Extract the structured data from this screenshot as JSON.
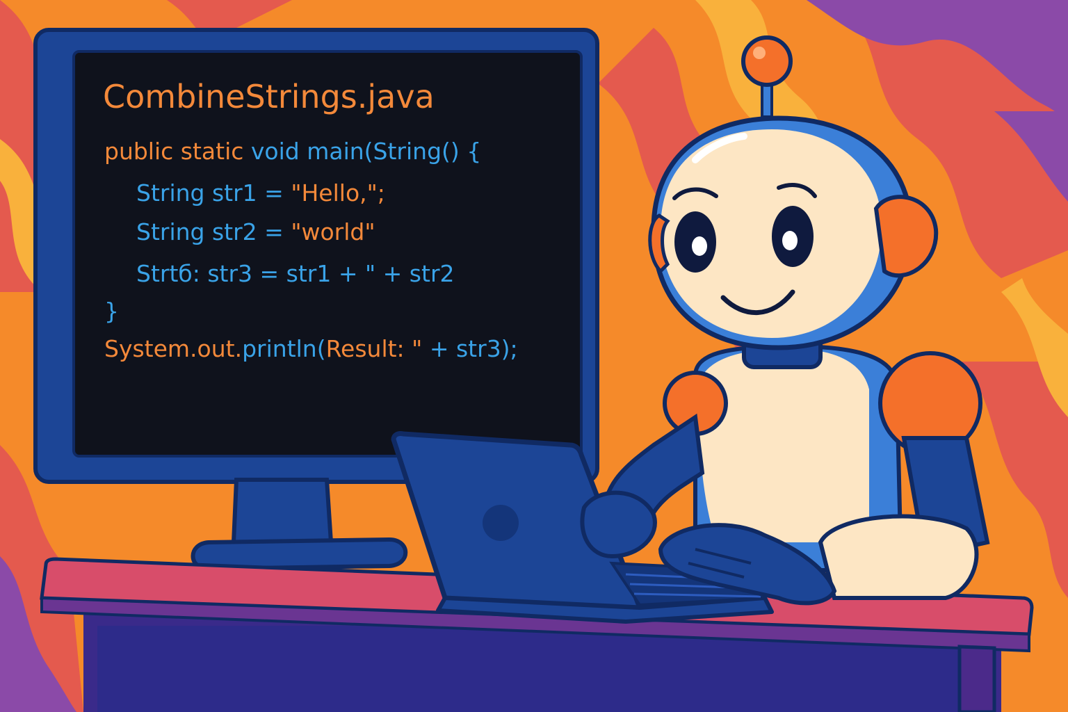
{
  "colors": {
    "background_orange": "#f58a2a",
    "background_red": "#e45a4e",
    "background_purple": "#8b4aa8",
    "monitor_blue": "#1c4596",
    "outline_navy": "#102a63",
    "screen_dark": "#0f121c",
    "code_orange": "#f4893a",
    "code_blue": "#3aa3e8",
    "robot_cream": "#fde6c4",
    "robot_blue": "#3b7fd8",
    "desk_pink": "#d84d6a",
    "desk_purple": "#6a3592"
  },
  "screen": {
    "file_title": "CombineStrings.java",
    "code": {
      "l1_a": "public static ",
      "l1_b": "void main(String() {",
      "l2_a": "String str1 = ",
      "l2_b": "\"Hello,\";",
      "l3_a": "String str2 = ",
      "l3_b": "\"world\"",
      "l4_a": "Strtб: str3 = str1 + \" + str2",
      "l5_a": "}",
      "l6_a": "System.out.",
      "l6_b": "println(",
      "l6_c": "Result: \"",
      "l6_d": " + str3);"
    }
  },
  "icons": {
    "robot": "robot-mascot-icon",
    "laptop": "laptop-icon",
    "monitor": "monitor-icon"
  }
}
